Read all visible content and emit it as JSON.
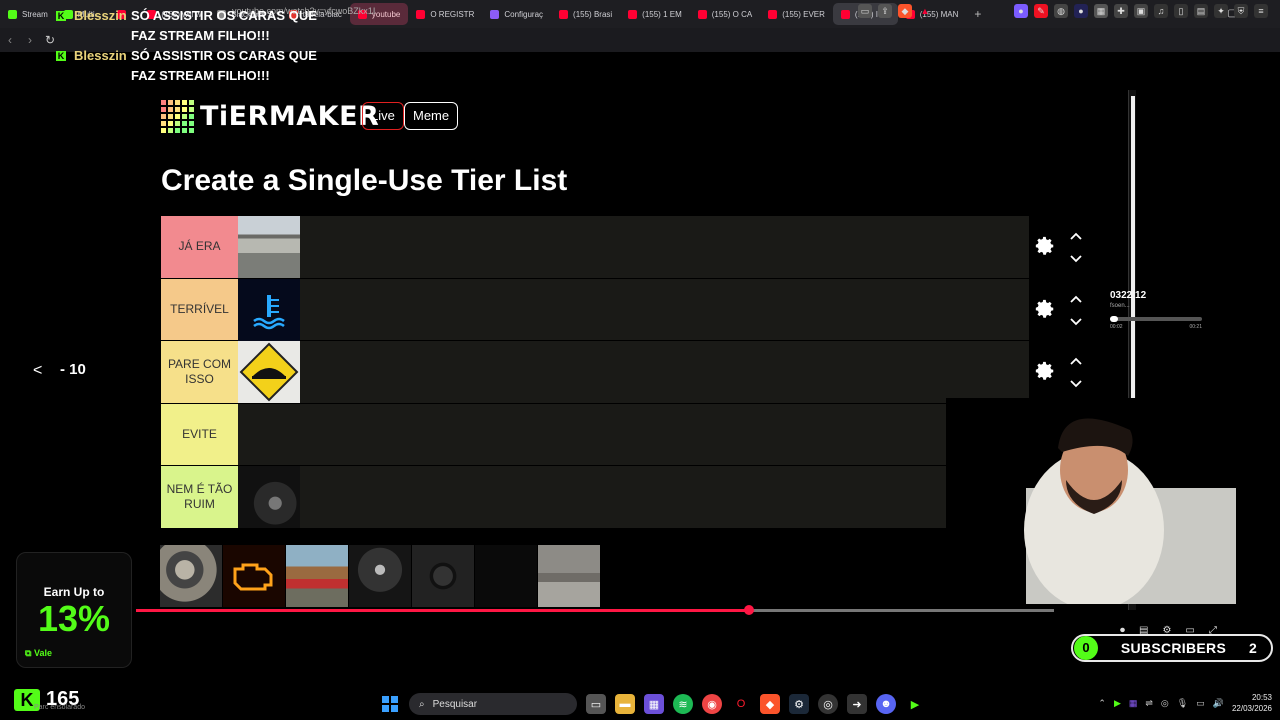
{
  "browser": {
    "tabs": [
      {
        "label": "Stream",
        "color": "#53fc18"
      },
      {
        "label": "Multi...",
        "color": "#53fc18"
      },
      {
        "label": "",
        "color": "#ff0033"
      },
      {
        "label": "(155) will w",
        "color": "#ff0033"
      },
      {
        "label": "Blackjack S",
        "color": "#888888"
      },
      {
        "label": "tabela-blac",
        "color": "#e3342f"
      },
      {
        "label": "youtube",
        "color": "#ff0033"
      },
      {
        "label": "O REGISTR",
        "color": "#ff0033"
      },
      {
        "label": "Configuraç",
        "color": "#8b5cf6"
      },
      {
        "label": "(155) Brasi",
        "color": "#ff0033"
      },
      {
        "label": "(155) 1 EM",
        "color": "#ff0033"
      },
      {
        "label": "(155) O CA",
        "color": "#ff0033"
      },
      {
        "label": "(155) EVER",
        "color": "#ff0033"
      },
      {
        "label": "(155) I",
        "color": "#ff0033"
      },
      {
        "label": "(155) MAN",
        "color": "#ff0033"
      }
    ],
    "new_tab": "+",
    "minimize": "—",
    "maximize": "▢",
    "close": "✕",
    "url": "youtube.com/watch?v=vfcwoBZkx1I"
  },
  "chat": [
    {
      "name": "Blesszin",
      "message_line1": "SÓ ASSISTIR OS CARAS QUE",
      "message_line2": "FAZ STREAM FILHO!!!"
    },
    {
      "name": "Blesszin",
      "message_line1": "SÓ ASSISTIR OS CARAS QUE",
      "message_line2": "FAZ STREAM FILHO!!!"
    }
  ],
  "tiermaker": {
    "logo": "TiERMAKER",
    "live": "Live",
    "meme": "Meme",
    "title": "Create a Single-Use Tier List",
    "tiers": [
      {
        "label": "JÁ ERA",
        "color": "#f28a8f"
      },
      {
        "label": "TERRÍVEL",
        "color": "#f5c98a"
      },
      {
        "label": "PARE COM ISSO",
        "color": "#f6e08a"
      },
      {
        "label": "EVITE",
        "color": "#f1f08a"
      },
      {
        "label": "NEM É TÃO RUIM",
        "color": "#d9f48c"
      }
    ]
  },
  "overlay": {
    "page_arrow": "<",
    "page_count": "- 10",
    "mini_time": "0322 12",
    "mini_sub": "fsoen...",
    "mini_start": "00:02",
    "mini_end": "00:21",
    "progress": 0.668
  },
  "earn": {
    "title": "Earn Up to",
    "value": "13%",
    "brand": "Vale"
  },
  "subs": {
    "left": "0",
    "label": "SUBSCRIBERS",
    "right": "2"
  },
  "viewer": {
    "count": "165",
    "sub": "Parc ensolarado"
  },
  "taskbar": {
    "search": "Pesquisar",
    "time": "20:53",
    "date": "22/03/2026"
  }
}
